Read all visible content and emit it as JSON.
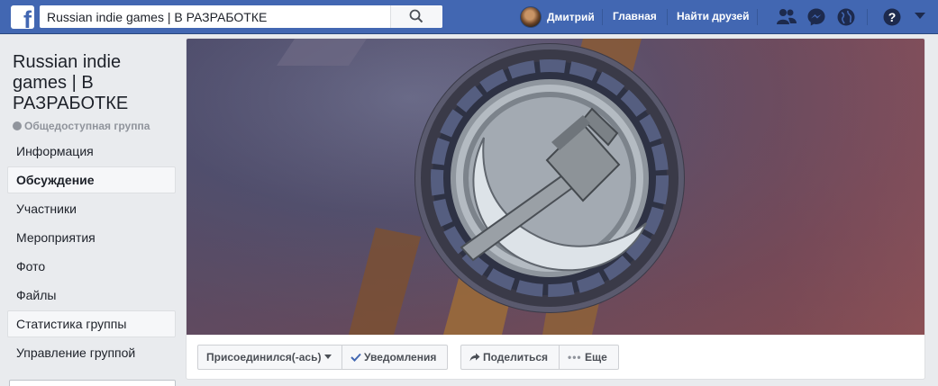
{
  "topbar": {
    "logo": "f",
    "search_value": "Russian indie games | В РАЗРАБОТКЕ",
    "user_name": "Дмитрий",
    "home_label": "Главная",
    "find_friends_label": "Найти друзей"
  },
  "group": {
    "title": "Russian indie games | В РАЗРАБОТКЕ",
    "type": "Общедоступная группа"
  },
  "sidebar": {
    "items": [
      {
        "label": "Информация"
      },
      {
        "label": "Обсуждение"
      },
      {
        "label": "Участники"
      },
      {
        "label": "Мероприятия"
      },
      {
        "label": "Фото"
      },
      {
        "label": "Файлы"
      },
      {
        "label": "Статистика группы"
      },
      {
        "label": "Управление группой"
      }
    ],
    "active_item": "Обсуждение"
  },
  "actions": {
    "joined_label": "Присоединился(-ась)",
    "notifications_label": "Уведомления",
    "share_label": "Поделиться",
    "more_label": "Еще"
  },
  "icons": {
    "search": "search-icon",
    "friends": "friends-icon",
    "messenger": "messenger-icon",
    "notifications": "globe-icon",
    "help": "help-icon",
    "account_menu": "caret-down-icon",
    "check": "check-icon",
    "share": "share-icon",
    "more": "ellipsis-icon"
  },
  "colors": {
    "brand_blue": "#4267b2",
    "link_blue": "#4267b2",
    "background": "#e9ebee"
  }
}
